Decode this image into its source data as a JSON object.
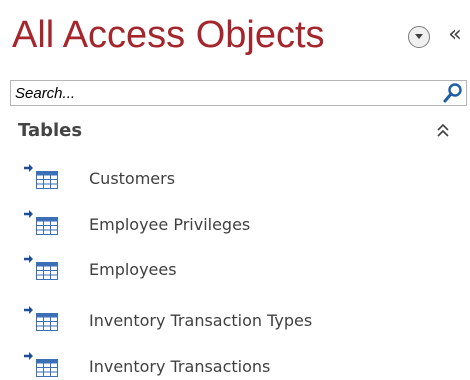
{
  "nav_pane": {
    "title": "All Access Objects",
    "menu_icon": "chevron-down-circle-icon",
    "collapse_symbol": "«",
    "collapse_icon": "double-chevron-left-icon",
    "title_color": "#a4262c"
  },
  "search": {
    "placeholder": "Search...",
    "value": "",
    "icon": "search-icon"
  },
  "groups": [
    {
      "label": "Tables",
      "collapse_icon": "double-chevron-up-icon",
      "items": [
        {
          "label": "Customers",
          "icon": "table-icon"
        },
        {
          "label": "Employee Privileges",
          "icon": "table-icon"
        },
        {
          "label": "Employees",
          "icon": "table-icon"
        },
        {
          "label": "Inventory Transaction Types",
          "icon": "table-icon"
        },
        {
          "label": "Inventory Transactions",
          "icon": "table-icon"
        }
      ]
    }
  ]
}
